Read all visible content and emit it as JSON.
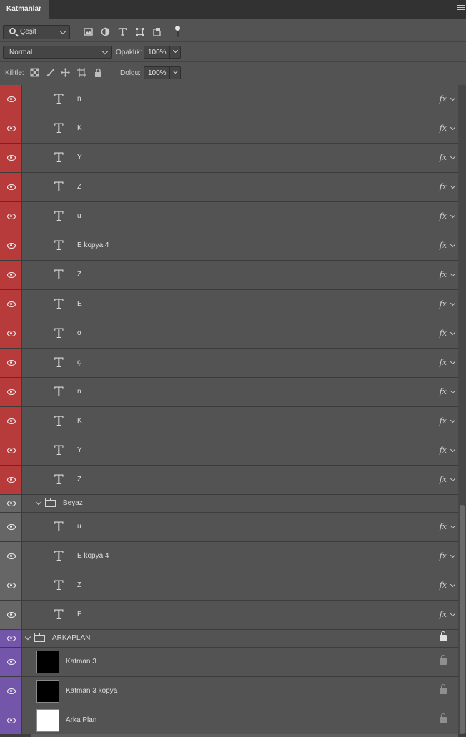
{
  "panel": {
    "tab_label": "Katmanlar",
    "menu_icon": "hamburger-menu-icon"
  },
  "filter": {
    "kind_label": "Çeşit",
    "icons": [
      "image-filter-icon",
      "adjustment-filter-icon",
      "type-filter-icon",
      "shape-filter-icon",
      "smart-object-filter-icon"
    ]
  },
  "blend": {
    "mode": "Normal",
    "opacity_label": "Opaklık:",
    "opacity": "100%"
  },
  "lock": {
    "label": "Kilitle:",
    "fill_label": "Dolgu:",
    "fill": "100%"
  },
  "colors": {
    "red": "#b83b3b",
    "gray": "#666666",
    "purple": "#7356aa"
  },
  "layers": [
    {
      "type": "text",
      "name": "n",
      "color": "red",
      "fx": "fx",
      "h": 41
    },
    {
      "type": "text",
      "name": "K",
      "color": "red",
      "fx": "fx",
      "h": 41
    },
    {
      "type": "text",
      "name": "Y",
      "color": "red",
      "fx": "fx",
      "h": 41
    },
    {
      "type": "text",
      "name": "Z",
      "color": "red",
      "fx": "fx",
      "h": 41
    },
    {
      "type": "text",
      "name": "u",
      "color": "red",
      "fx": "fx",
      "h": 41
    },
    {
      "type": "text",
      "name": "E kopya 4",
      "color": "red",
      "fx": "fx",
      "h": 41
    },
    {
      "type": "text",
      "name": "Z",
      "color": "red",
      "fx": "fx",
      "h": 41
    },
    {
      "type": "text",
      "name": "E",
      "color": "red",
      "fx": "fx",
      "h": 41
    },
    {
      "type": "text",
      "name": "o",
      "color": "red",
      "fx": "fx",
      "h": 41
    },
    {
      "type": "text",
      "name": "ç",
      "color": "red",
      "fx": "fx",
      "h": 41
    },
    {
      "type": "text",
      "name": "n",
      "color": "red",
      "fx": "fx",
      "h": 41
    },
    {
      "type": "text",
      "name": "K",
      "color": "red",
      "fx": "fx",
      "h": 41
    },
    {
      "type": "text",
      "name": "Y",
      "color": "red",
      "fx": "fx",
      "h": 41
    },
    {
      "type": "text",
      "name": "Z",
      "color": "red",
      "fx": "fx",
      "h": 41
    },
    {
      "type": "group",
      "name": "Beyaz",
      "color": "gray",
      "indent": 1,
      "h": 25
    },
    {
      "type": "text",
      "name": "u",
      "color": "gray",
      "fx": "fx",
      "h": 41
    },
    {
      "type": "text",
      "name": "E kopya 4",
      "color": "gray",
      "fx": "fx",
      "h": 41
    },
    {
      "type": "text",
      "name": "Z",
      "color": "gray",
      "fx": "fx",
      "h": 41
    },
    {
      "type": "text",
      "name": "E",
      "color": "gray",
      "fx": "fx",
      "h": 41
    },
    {
      "type": "group",
      "name": "ARKAPLAN",
      "color": "purple",
      "indent": 0,
      "locked": true,
      "h": 25
    },
    {
      "type": "pixel",
      "name": "Katman 3",
      "color": "purple",
      "thumb": "#000000",
      "locked": true,
      "h": 41
    },
    {
      "type": "pixel",
      "name": "Katman 3 kopya",
      "color": "purple",
      "thumb": "#000000",
      "locked": true,
      "h": 41
    },
    {
      "type": "pixel",
      "name": "Arka Plan",
      "color": "purple",
      "thumb": "#ffffff",
      "locked": true,
      "h": 41
    }
  ]
}
